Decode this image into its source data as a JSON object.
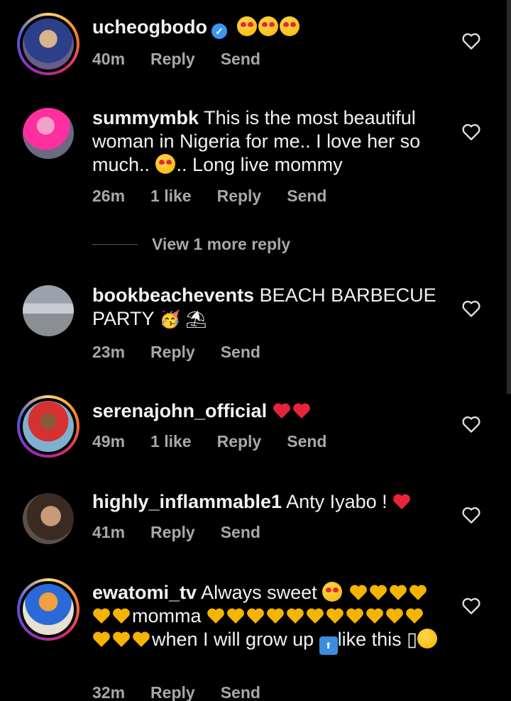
{
  "comments": [
    {
      "username": "ucheogbodo",
      "verified": true,
      "text": "",
      "emoji_after": "😍😍😍",
      "time": "40m",
      "likes": "",
      "reply": "Reply",
      "send": "Send",
      "avatar_ring": true
    },
    {
      "username": "summymbk",
      "text_1": "This is the most beautiful woman in Nigeria for me.. I love her so much..",
      "text_2": ".. Long live mommy",
      "time": "26m",
      "likes": "1 like",
      "reply": "Reply",
      "send": "Send",
      "avatar_ring": false
    },
    {
      "username": "bookbeachevents",
      "text": "BEACH BARBECUE PARTY",
      "emoji_after": "🥳 ⛱",
      "time": "23m",
      "reply": "Reply",
      "send": "Send",
      "avatar_ring": false
    },
    {
      "username": "serenajohn_official",
      "time": "49m",
      "likes": "1 like",
      "reply": "Reply",
      "send": "Send",
      "avatar_ring": true
    },
    {
      "username": "highly_inflammable1",
      "text": "Anty Iyabo !",
      "time": "41m",
      "reply": "Reply",
      "send": "Send",
      "avatar_ring": false
    },
    {
      "username": "ewatomi_tv",
      "text_1": "Always sweet",
      "text_2": "momma",
      "text_3": "when I will grow up",
      "text_4": "like this",
      "unknown_glyph": "▯",
      "time": "32m",
      "reply": "Reply",
      "send": "Send",
      "avatar_ring": true
    }
  ],
  "view_more_replies": "View 1 more reply",
  "colors": {
    "background": "#000000",
    "text": "#f2f2f2",
    "meta": "#a8a8a8",
    "verified": "#3897f0",
    "heart": "#e8243a",
    "yellow_heart": "#f5b400"
  }
}
